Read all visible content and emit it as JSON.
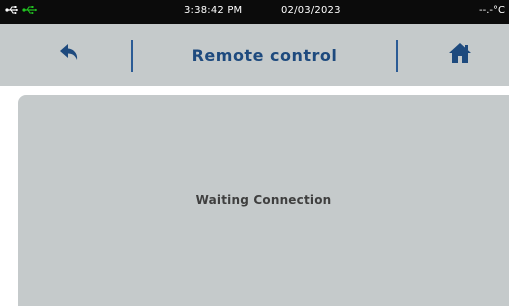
{
  "status_bar": {
    "time": "3:38:42 PM",
    "date": "02/03/2023",
    "temperature": "--.-°C",
    "icons": [
      "usb-icon",
      "usb-connected-icon"
    ]
  },
  "header": {
    "title": "Remote control",
    "back_icon": "back-arrow-icon",
    "home_icon": "home-icon"
  },
  "main": {
    "message": "Waiting Connection"
  },
  "colors": {
    "status_bg": "#0b0b0b",
    "header_bg": "#c5cacb",
    "accent": "#1e4a7e",
    "usb_active": "#22c522"
  }
}
